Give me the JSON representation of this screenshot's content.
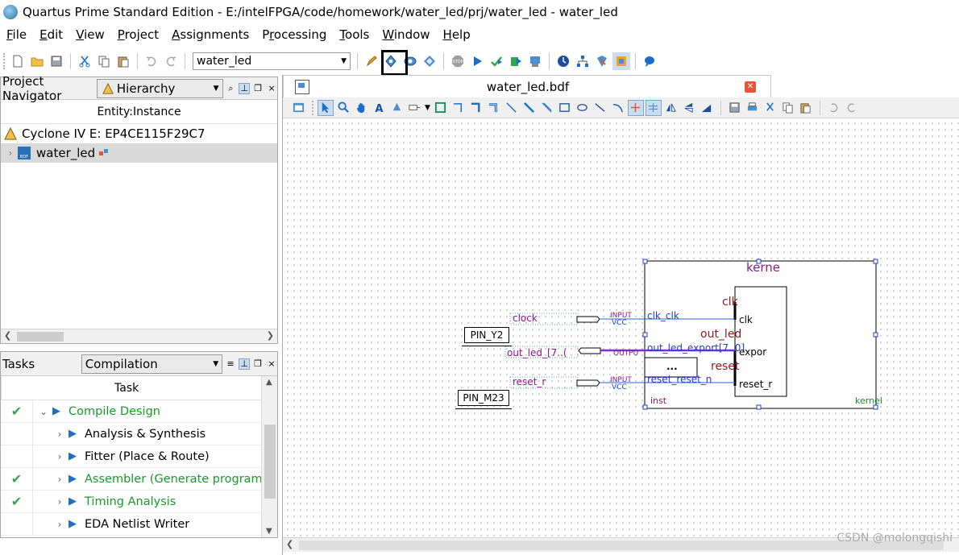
{
  "window": {
    "title": "Quartus Prime Standard Edition - E:/intelFPGA/code/homework/water_led/prj/water_led - water_led"
  },
  "menu": {
    "items": [
      {
        "label": "File",
        "mnemonic": "F",
        "rest": "ile"
      },
      {
        "label": "Edit",
        "mnemonic": "E",
        "rest": "dit"
      },
      {
        "label": "View",
        "mnemonic": "V",
        "rest": "iew"
      },
      {
        "label": "Project",
        "mnemonic": "P",
        "rest": "roject"
      },
      {
        "label": "Assignments",
        "mnemonic": "A",
        "rest": "ssignments"
      },
      {
        "label": "Processing",
        "mnemonic": "r",
        "pre": "P",
        "rest": "ocessing"
      },
      {
        "label": "Tools",
        "mnemonic": "T",
        "rest": "ools"
      },
      {
        "label": "Window",
        "mnemonic": "W",
        "rest": "indow"
      },
      {
        "label": "Help",
        "mnemonic": "H",
        "rest": "elp"
      }
    ]
  },
  "toolbar": {
    "entity_value": "water_led"
  },
  "navigator": {
    "title": "Project Navigator",
    "view_select": "Hierarchy",
    "column_header": "Entity:Instance",
    "device": "Cyclone IV E: EP4CE115F29C7",
    "top_entity": "water_led"
  },
  "tasks": {
    "title": "Tasks",
    "flow_select": "Compilation",
    "column_header": "Task",
    "rows": [
      {
        "label": "Compile Design",
        "done": true,
        "expanded": true,
        "green": true
      },
      {
        "label": "Analysis & Synthesis",
        "done": false,
        "green": false
      },
      {
        "label": "Fitter (Place & Route)",
        "done": false,
        "green": false
      },
      {
        "label": "Assembler (Generate programm",
        "done": true,
        "green": true
      },
      {
        "label": "Timing Analysis",
        "done": true,
        "green": true
      },
      {
        "label": "EDA Netlist Writer",
        "done": false,
        "green": false
      }
    ]
  },
  "editor": {
    "tab_title": "water_led.bdf"
  },
  "schematic": {
    "pins": {
      "pin_y2": "PIN_Y2",
      "pin_m23": "PIN_M23"
    },
    "nets": {
      "clock": "clock",
      "out_led": "out_led_[7..(",
      "reset": "reset_r"
    },
    "io_tags": {
      "input1": "INPUT",
      "vcc1": "VCC",
      "output": "OUTPU",
      "input2": "INPUT",
      "vcc2": "VCC"
    },
    "symbol": {
      "title": "kerne",
      "ports_left": {
        "clk": "clk_clk",
        "out": "out_led_export[7..0]",
        "reset": "reset_reset_n"
      },
      "inner_labels": {
        "clk_big": "clk",
        "out_big": "out_led",
        "reset_big": "reset"
      },
      "inner_ports": {
        "clk": "clk",
        "export": "expor",
        "reset": "reset_r"
      },
      "param_box": "...",
      "inst": "inst",
      "footer": "kernel"
    }
  },
  "watermark": "CSDN @molongqishi",
  "colors": {
    "accent_blue": "#1b6fc9",
    "success_green": "#2da84a",
    "schematic_purple": "#8b1a8b",
    "bus_purple": "#7b2fd0"
  }
}
